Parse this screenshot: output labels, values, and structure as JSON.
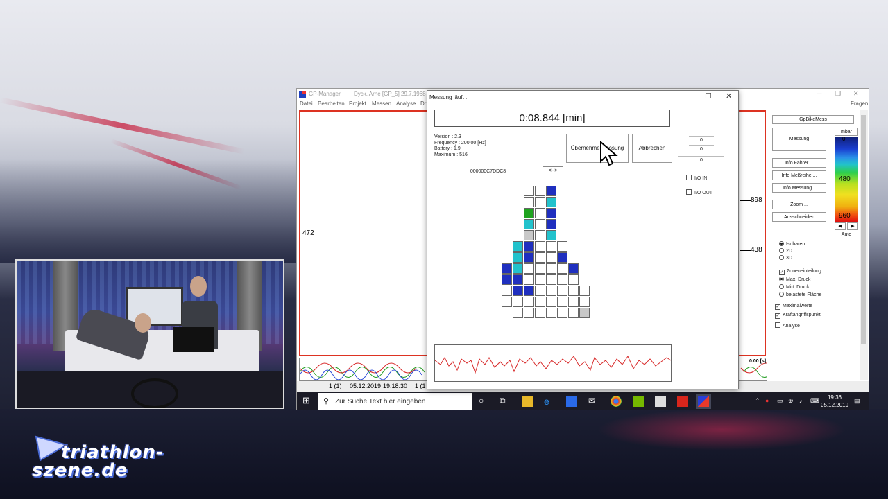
{
  "window": {
    "title": "GP-Manager",
    "title_extra": "Dyck, Arne  [GP_5]  29.7.1968",
    "menu": [
      "Datei",
      "Bearbeiten",
      "Projekt",
      "Messen",
      "Analyse",
      "Dr"
    ],
    "help_menu": "Fragen"
  },
  "plot": {
    "left_label": "472",
    "right_label_top": "898",
    "right_label_mid": "438",
    "time_readout": "0.00 [s]"
  },
  "dialog": {
    "title": "Messung läuft ..",
    "timer": "0:08.844 [min]",
    "info": [
      "Version : 2.3",
      "Frequency : 200.00 [Hz]",
      "Battery : 1.9",
      "Maximum : 516"
    ],
    "device_id": "000000C7DDC8",
    "swap_button": "<-->",
    "accept_button": "Übernehme Messung",
    "cancel_button": "Abbrechen",
    "numbers": [
      "0",
      "0",
      "0"
    ],
    "io_in": "I/O IN",
    "io_out": "I/O OUT"
  },
  "right_panel": {
    "header": "GpBikeMess",
    "measure_button": "Messung",
    "info_driver": "Info Fahrer ...",
    "info_series": "Info Meßreihe ...",
    "info_measurement": "Info Messung...",
    "zoom": "Zoom ...",
    "cut": "Ausschneiden",
    "unit": "mbar",
    "scale_labels": [
      "0",
      "480",
      "960"
    ],
    "auto": "Auto",
    "view_options": [
      "Isobaren",
      "2D",
      "3D"
    ],
    "zone_label": "Zoneneinteilung",
    "zone_options": [
      "Max. Druck",
      "Mitt. Druck",
      "belastete Fläche"
    ],
    "checks": [
      "Maximalwerte",
      "Kraftangriffspunkt",
      "Analyse"
    ]
  },
  "status": {
    "page": "1 (1)",
    "date": "05.12.2019",
    "time": "19:18:30",
    "page2": "1 (1"
  },
  "taskbar": {
    "search_placeholder": "Zur Suche Text hier eingeben",
    "clock_time": "19:36",
    "clock_date": "05.12.2019"
  },
  "logo": {
    "line1": "triathlon-",
    "line2": "szene.de"
  },
  "colors": {
    "dark_blue": "#1f2fbf",
    "cyan": "#22c2cc",
    "green": "#1fa31f",
    "gray": "#c8c8c8",
    "plot_red": "#d32a2a"
  },
  "pressure_grid": [
    [
      null,
      null,
      "w",
      "w",
      "db",
      null
    ],
    [
      null,
      null,
      "w",
      "w",
      "cy",
      null
    ],
    [
      null,
      null,
      "g",
      "w",
      "db",
      null
    ],
    [
      null,
      null,
      "cy",
      "w",
      "db",
      null
    ],
    [
      null,
      null,
      "gr",
      "w",
      "cy",
      null
    ],
    [
      null,
      "cy",
      "db",
      "w",
      "w",
      "w"
    ],
    [
      null,
      "cy",
      "db",
      "w",
      "w",
      "g2"
    ],
    [
      "db",
      "cy",
      "w",
      "w",
      "w",
      "w",
      "db"
    ],
    [
      "db",
      "db",
      "w",
      "w",
      "w",
      "w",
      "w"
    ],
    [
      "w",
      "db",
      "db",
      "w",
      "w",
      "w",
      "w",
      "w"
    ],
    [
      "w",
      "w",
      "w",
      "w",
      "w",
      "w",
      "w",
      "w"
    ],
    [
      null,
      "w",
      "w",
      "w",
      "w",
      "w",
      "w",
      "gr"
    ]
  ]
}
